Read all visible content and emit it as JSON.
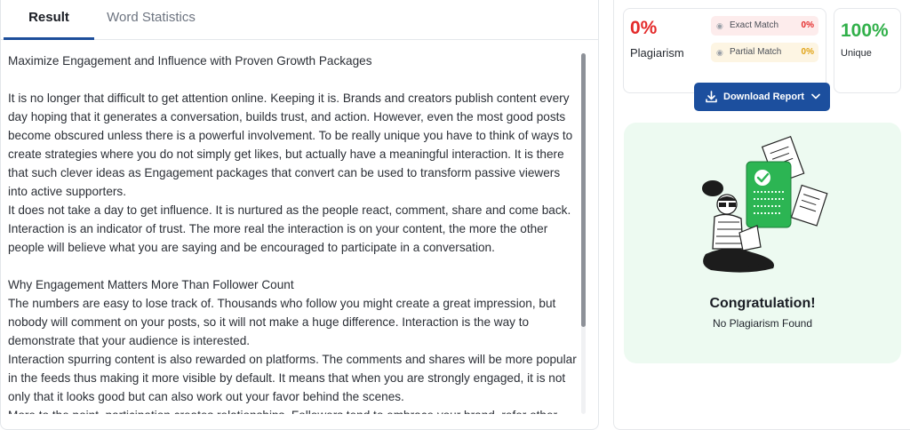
{
  "tabs": [
    {
      "label": "Result",
      "active": true
    },
    {
      "label": "Word Statistics",
      "active": false
    }
  ],
  "document": {
    "title": "Maximize Engagement and Influence with Proven Growth Packages",
    "p1": "It is no longer that difficult to get attention online. Keeping it is. Brands and creators publish content every day hoping that it generates a conversation, builds trust, and action. However, even the most good posts become obscured unless there is a powerful involvement. To be really unique you have to think of ways to create strategies where you do not simply get likes, but actually have a meaningful interaction. It is there that such clever ideas as Engagement packages that convert can be used to transform passive viewers into active supporters.",
    "p2": "It does not take a day to get influence. It is nurtured as the people react, comment, share and come back. Interaction is an indicator of trust. The more real the interaction is on your content, the more the other people will believe what you are saying and be encouraged to participate in a conversation.",
    "heading2": "Why Engagement Matters More Than Follower Count",
    "p3": "The numbers are easy to lose track of. Thousands who follow you might create a great impression, but nobody will comment on your posts, so it will not make a huge difference. Interaction is the way to demonstrate that your audience is interested.",
    "p4": "Interaction spurring content is also rewarded on platforms. The comments and shares will be more popular in the feeds thus making it more visible by default. It means that when you are strongly engaged, it is not only that it looks good but can also work out your favor behind the scenes.",
    "p5": "More to the point, participation creates relationships. Followers tend to embrace your brand, refer other"
  },
  "stats": {
    "plagiarism_pct": "0%",
    "plagiarism_label": "Plagiarism",
    "exact_label": "Exact Match",
    "exact_value": "0%",
    "partial_label": "Partial Match",
    "partial_value": "0%",
    "unique_pct": "100%",
    "unique_label": "Unique"
  },
  "download": {
    "label": "Download Report"
  },
  "result": {
    "title": "Congratulation!",
    "subtitle": "No Plagiarism Found"
  },
  "colors": {
    "accent": "#1c4f9e",
    "plagiarism_red": "#e42b2b",
    "unique_green": "#31b04a",
    "partial_amber": "#e0a315",
    "success_bg": "#edfaf1"
  },
  "icons": [
    "eye-icon",
    "download-icon",
    "chevron-down-icon",
    "success-illustration"
  ]
}
